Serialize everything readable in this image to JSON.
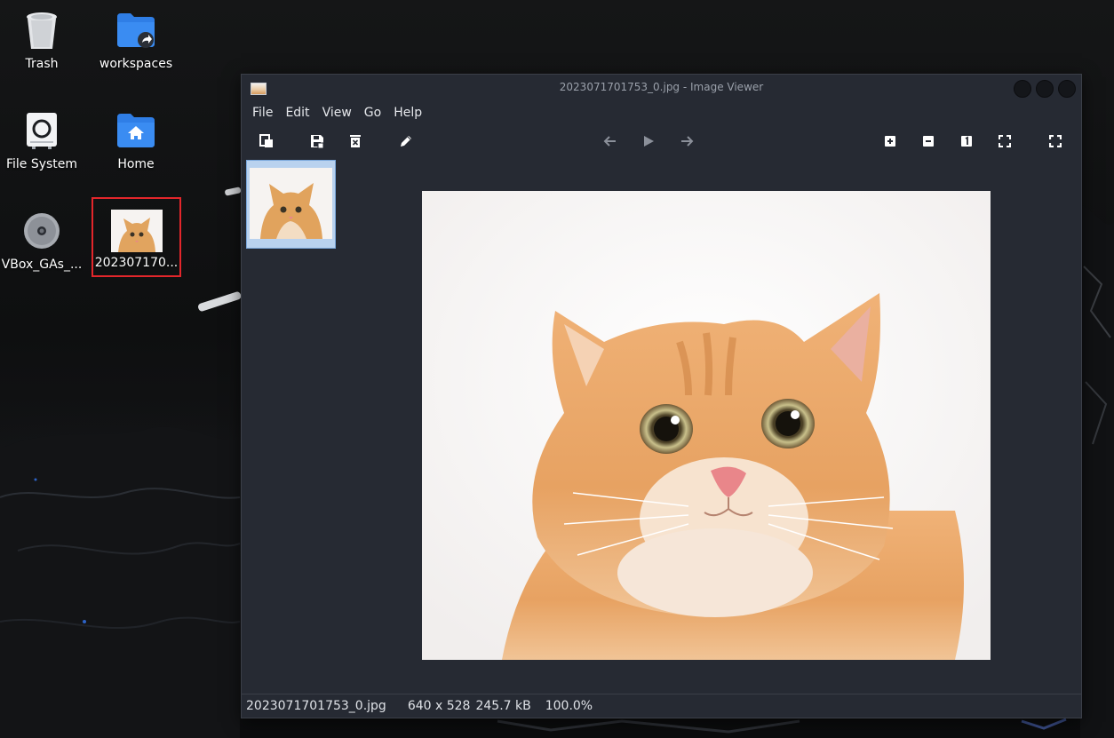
{
  "desktop": {
    "icons": [
      {
        "label": "Trash",
        "icon": "trash-icon"
      },
      {
        "label": "workspaces",
        "icon": "folder-shared-icon"
      },
      {
        "label": "File System",
        "icon": "drive-icon"
      },
      {
        "label": "Home",
        "icon": "home-folder-icon"
      },
      {
        "label": "VBox_GAs_...",
        "icon": "optical-disc-icon"
      },
      {
        "label": "202307170...",
        "icon": "image-file-icon",
        "selected": true
      }
    ]
  },
  "window": {
    "title": "2023071701753_0.jpg - Image Viewer",
    "menu": [
      "File",
      "Edit",
      "View",
      "Go",
      "Help"
    ],
    "toolbar": {
      "left": [
        "open-icon",
        "save-icon",
        "delete-icon",
        "edit-icon"
      ],
      "center": [
        "back-icon",
        "play-icon",
        "forward-icon"
      ],
      "right": [
        "zoom-in-icon",
        "zoom-out-icon",
        "zoom-100-icon",
        "zoom-fit-icon",
        "fullscreen-icon"
      ]
    },
    "status": {
      "filename": "2023071701753_0.jpg",
      "dimensions": "640 x 528",
      "size": "245.7 kB",
      "zoom": "100.0%"
    }
  },
  "colors": {
    "window_bg": "#262a33",
    "selection_outline": "#e3262b",
    "thumb_selection": "#b9d2ef",
    "folder_blue": "#2f7ee6"
  }
}
